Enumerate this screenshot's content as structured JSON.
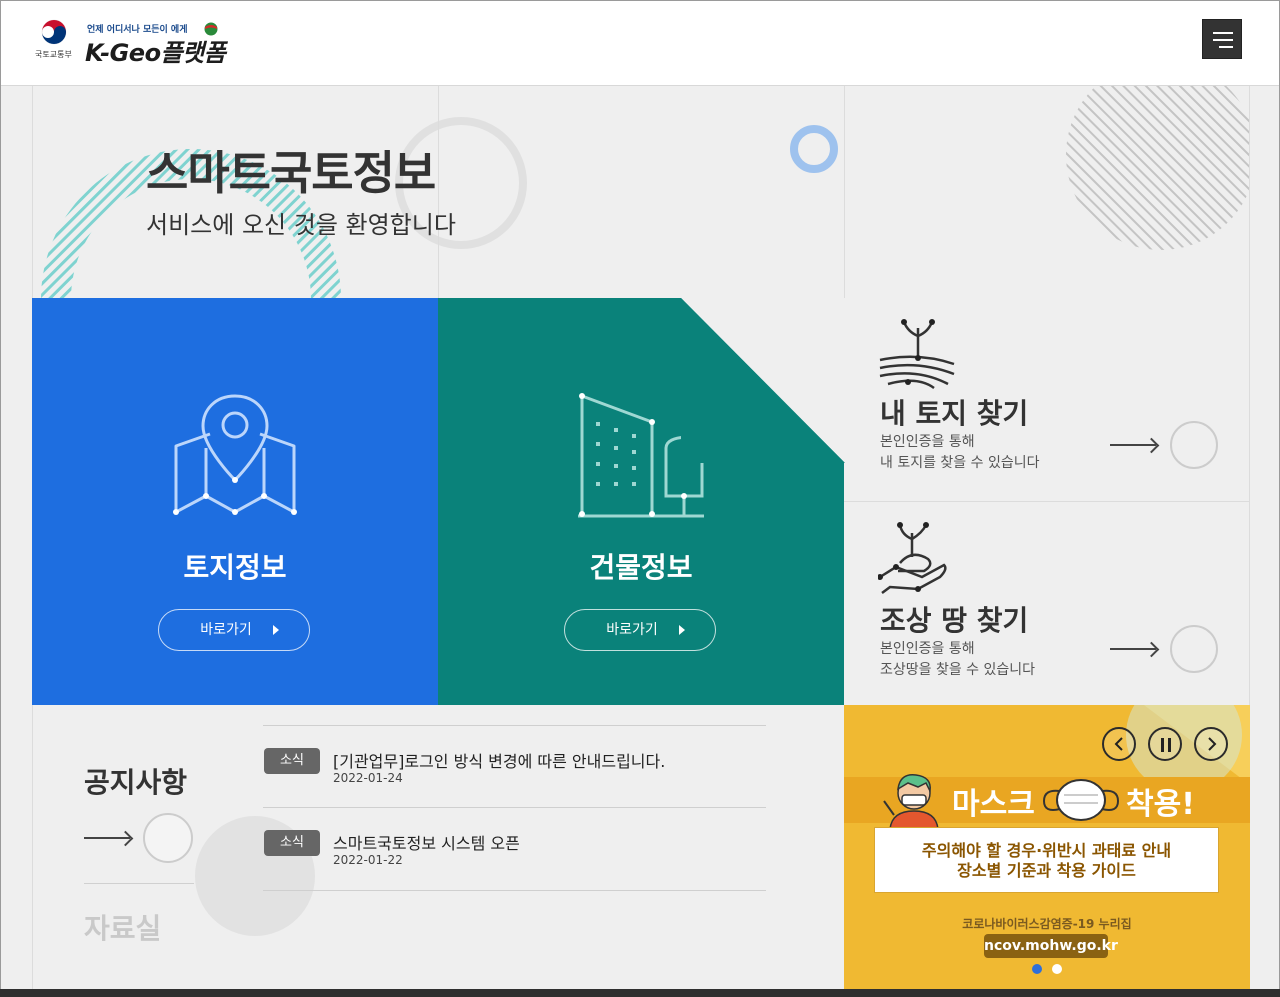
{
  "header": {
    "ministry_name": "국토교통부",
    "slogan": "언제 어디서나 모든이 에게",
    "brand": "K-Geo플랫폼",
    "menu_icon": "hamburger-icon"
  },
  "hero": {
    "title": "스마트국토정보",
    "subtitle": "서비스에 오신 것을 환영합니다"
  },
  "tiles": [
    {
      "title": "토지정보",
      "button": "바로가기",
      "icon": "map-pin-icon",
      "color": "#1e6ee0"
    },
    {
      "title": "건물정보",
      "button": "바로가기",
      "icon": "building-icon",
      "color": "#0a827a"
    }
  ],
  "cards": [
    {
      "title": "내 토지 찾기",
      "desc1": "본인인증을 통해",
      "desc2": "내 토지를 찾을 수 있습니다",
      "icon": "land-sprout-icon"
    },
    {
      "title": "조상 땅 찾기",
      "desc1": "본인인증을 통해",
      "desc2": "조상땅을 찾을 수 있습니다",
      "icon": "hand-sprout-icon"
    }
  ],
  "notice": {
    "title": "공지사항",
    "archive_title": "자료실",
    "items": [
      {
        "badge": "소식",
        "text": "[기관업무]로그인 방식 변경에 따른 안내드립니다.",
        "date": "2022-01-24"
      },
      {
        "badge": "소식",
        "text": "스마트국토정보 시스템 오픈",
        "date": "2022-01-22"
      }
    ]
  },
  "banner": {
    "headline_left": "마스크",
    "headline_right": "착용!",
    "line1": "주의해야 할 경우·위반시 과태료 안내",
    "line2": "장소별 기준과 착용 가이드",
    "source": "코로나바이러스감염증-19 누리집",
    "url": "ncov.mohw.go.kr",
    "active_slide": 1,
    "colors": {
      "background": "#f0b932",
      "accent": "#8a6212"
    }
  }
}
